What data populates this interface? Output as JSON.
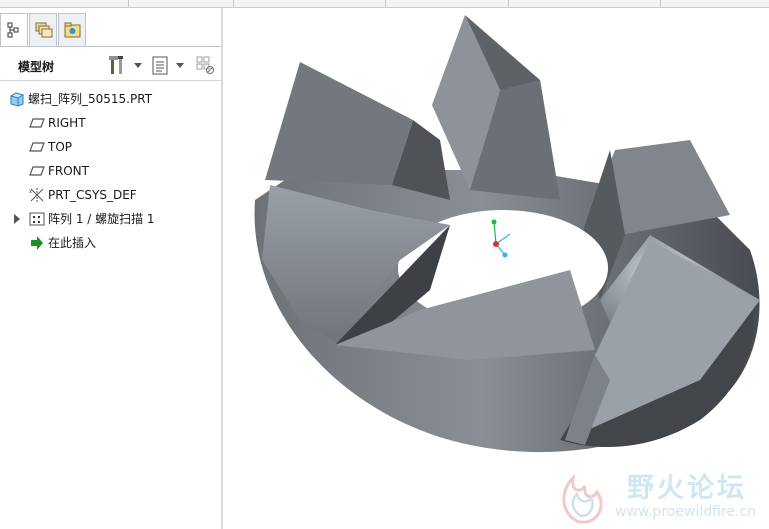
{
  "tabs": [
    {
      "name": "model-tree-tab",
      "icon": "tree-icon",
      "active": true
    },
    {
      "name": "layers-tab",
      "icon": "layers-icon",
      "active": false
    },
    {
      "name": "favorites-tab",
      "icon": "star-folder-icon",
      "active": false
    }
  ],
  "model_tree": {
    "title": "模型树",
    "root": {
      "label": "螺扫_阵列_50515.PRT",
      "icon": "part-icon"
    },
    "items": [
      {
        "label": "RIGHT",
        "icon": "datum-plane-icon"
      },
      {
        "label": "TOP",
        "icon": "datum-plane-icon"
      },
      {
        "label": "FRONT",
        "icon": "datum-plane-icon"
      },
      {
        "label": "PRT_CSYS_DEF",
        "icon": "csys-icon"
      },
      {
        "label": "阵列 1 / 螺旋扫描 1",
        "icon": "pattern-icon",
        "expandable": true
      },
      {
        "label": "在此插入",
        "icon": "insert-arrow-icon"
      }
    ]
  },
  "watermark": {
    "title": "野火论坛",
    "url": "www.proewildfire.cn"
  },
  "colors": {
    "insert_arrow": "#1f8f2a",
    "part_icon": "#4aa3d8",
    "axis_x": "#e03030",
    "axis_y": "#22b24c",
    "axis_z": "#2bb6e6"
  }
}
